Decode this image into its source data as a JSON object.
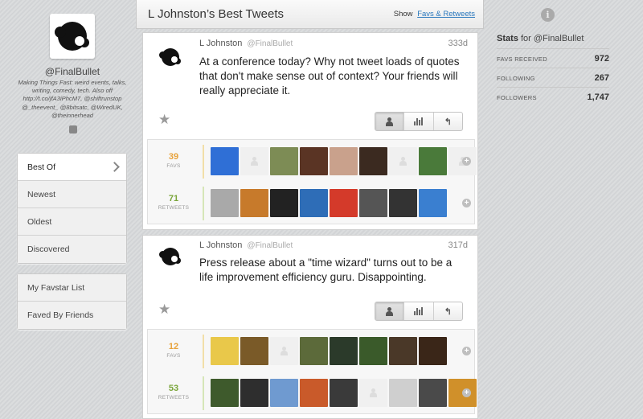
{
  "profile": {
    "handle": "@FinalBullet",
    "bio": "Making Things Fast: weird events, talks, writing, comedy, tech. Also off http://t.co/jfA3iPhcM7, @shiftrunstop @_theevent_ @8bitsatc, @WiredUK, @theinnerhead"
  },
  "nav": {
    "group1": [
      {
        "label": "Best Of",
        "active": true
      },
      {
        "label": "Newest"
      },
      {
        "label": "Oldest"
      },
      {
        "label": "Discovered"
      }
    ],
    "group2": [
      {
        "label": "My Favstar List"
      },
      {
        "label": "Faved By Friends"
      }
    ]
  },
  "header": {
    "title": "L Johnston’s Best Tweets",
    "show_label": "Show",
    "show_link": "Favs & Retweets"
  },
  "tweets": [
    {
      "name": "L Johnston",
      "handle": "@FinalBullet",
      "age": "333d",
      "text": "At a conference today? Why not tweet loads of quotes that don't make sense out of context? Your friends will really appreciate it.",
      "favs": {
        "count": "39",
        "label": "FAVS"
      },
      "retweets": {
        "count": "71",
        "label": "RETWEETS"
      }
    },
    {
      "name": "L Johnston",
      "handle": "@FinalBullet",
      "age": "317d",
      "text": "Press release about a \"time wizard\" turns out to be a life improvement efficiency guru. Disappointing.",
      "favs": {
        "count": "12",
        "label": "FAVS"
      },
      "retweets": {
        "count": "53",
        "label": "RETWEETS"
      }
    }
  ],
  "stats": {
    "title_prefix": "Stats",
    "title_suffix": "for @FinalBullet",
    "rows": [
      {
        "label": "FAVS RECEIVED",
        "value": "972"
      },
      {
        "label": "FOLLOWING",
        "value": "267"
      },
      {
        "label": "FOLLOWERS",
        "value": "1,747"
      }
    ]
  },
  "icons": {
    "info": "info-icon",
    "twitter": "twitter-bird-icon",
    "star": "star-icon",
    "person": "person-icon",
    "chart": "bar-chart-icon",
    "reply": "reply-arrow-icon",
    "plus": "plus-icon"
  },
  "colors": {
    "favs": "#e7a23b",
    "retweets": "#7aa53a",
    "link": "#2a78bd"
  }
}
